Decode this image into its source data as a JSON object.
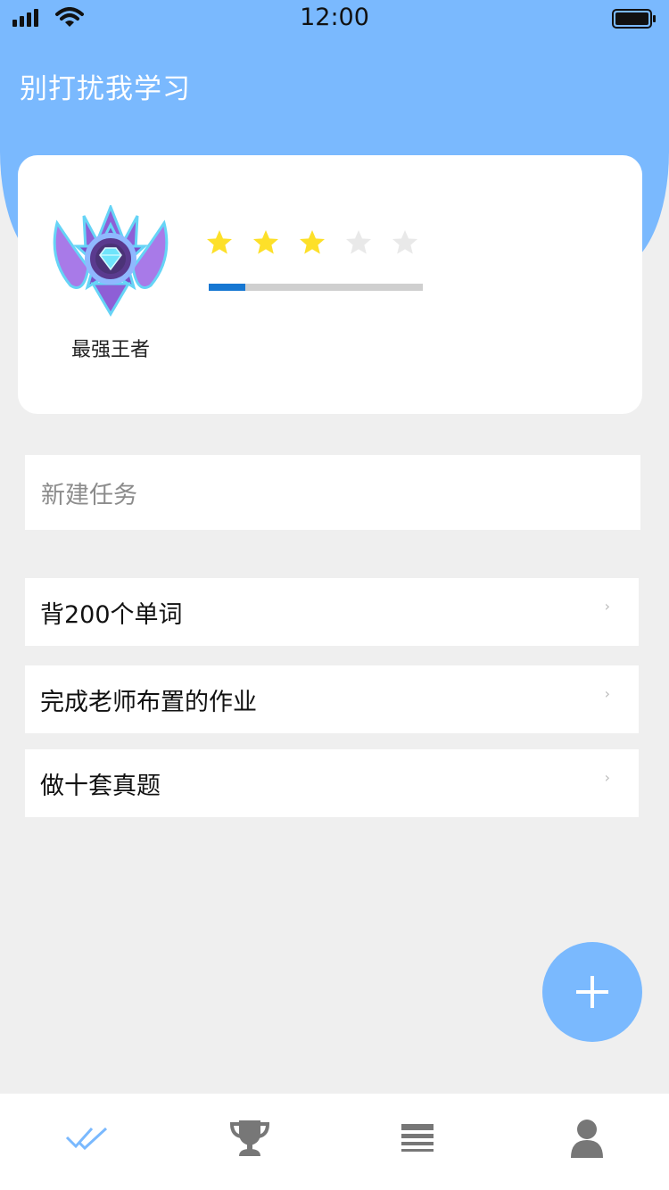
{
  "status_bar": {
    "time": "12:00",
    "icons": [
      "signal-icon",
      "wifi-icon",
      "battery-icon"
    ]
  },
  "header": {
    "title": "别打扰我学习"
  },
  "rank_card": {
    "rank_name": "最强王者",
    "badge_icon": "diamond-badge-icon",
    "stars_total": 5,
    "stars_filled": 3,
    "progress_fraction": 0.17
  },
  "new_task": {
    "placeholder": "新建任务"
  },
  "tasks": [
    {
      "label": "背200个单词"
    },
    {
      "label": "完成老师布置的作业"
    },
    {
      "label": "做十套真题"
    }
  ],
  "fab": {
    "icon": "plus-icon"
  },
  "tab_bar": {
    "items": [
      {
        "icon": "double-check-icon",
        "active": true
      },
      {
        "icon": "trophy-icon",
        "active": false
      },
      {
        "icon": "list-icon",
        "active": false
      },
      {
        "icon": "user-icon",
        "active": false
      }
    ]
  },
  "colors": {
    "primary": "#7ab9fe",
    "progress": "#1677d2",
    "star_filled": "#fde029",
    "star_empty": "#e9e9e9",
    "tab_inactive": "#777777"
  }
}
